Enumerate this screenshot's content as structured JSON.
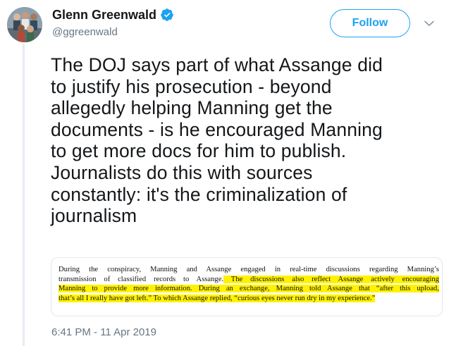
{
  "author": {
    "display_name": "Glenn Greenwald",
    "handle": "@ggreenwald",
    "verified": true,
    "avatar_icon": "group-photo-avatar"
  },
  "actions": {
    "follow_label": "Follow",
    "menu_icon": "chevron-down-icon"
  },
  "tweet": {
    "text": "The DOJ says part of what Assange did\nto justify his prosecution - beyond\nallegedly helping Manning get the\ndocuments - is he encouraged Manning\nto get more docs for him to publish.\nJournalists do this with sources\nconstantly: it's the criminalization of\njournalism",
    "timestamp": "6:41 PM - 11 Apr 2019"
  },
  "attached_image": {
    "lines": [
      {
        "plain": "During the conspiracy, Manning and Assange engaged in real-time discussions regarding Manning’s",
        "highlight": ""
      },
      {
        "plain": "transmission of classified records to Assange.",
        "highlight": " The discussions also reflect Assange actively encouraging"
      },
      {
        "plain": "",
        "highlight": "Manning to provide more information. During an exchange, Manning told Assange that “after this upload,"
      },
      {
        "plain": "",
        "highlight": "that’s all I really have got left.” To which Assange replied, “curious eyes never run dry in my experience.”"
      }
    ]
  },
  "colors": {
    "brand_blue": "#1da1f2",
    "secondary_text": "#657786",
    "highlight": "#fff200",
    "thread_line": "#e6ecf0"
  }
}
